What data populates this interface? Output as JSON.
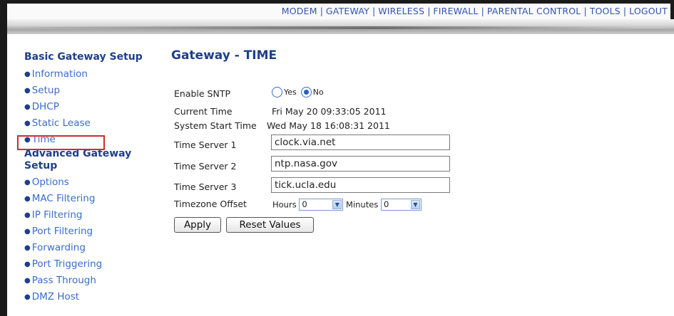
{
  "topnav": {
    "links": [
      "MODEM",
      "GATEWAY",
      "WIRELESS",
      "FIREWALL",
      "PARENTAL CONTROL",
      "TOOLS",
      "LOGOUT"
    ]
  },
  "sidebar": {
    "basic_heading": "Basic Gateway Setup",
    "basic_items": [
      "Information",
      "Setup",
      "DHCP",
      "Static Lease",
      "Time"
    ],
    "advanced_heading_line1": "Advanced Gateway",
    "advanced_heading_line2": "Setup",
    "advanced_items": [
      "Options",
      "MAC Filtering",
      "IP Filtering",
      "Port Filtering",
      "Forwarding",
      "Port Triggering",
      "Pass Through",
      "DMZ Host"
    ],
    "highlighted_item": "Time",
    "highlight_color": "#d22a2a"
  },
  "main": {
    "title": "Gateway - TIME",
    "enable_sntp": {
      "label": "Enable SNTP",
      "options": [
        "Yes",
        "No"
      ],
      "selected": "No"
    },
    "current_time": {
      "label": "Current Time",
      "value": "Fri May 20 09:33:05 2011"
    },
    "system_start_time": {
      "label": "System Start Time",
      "value": "Wed May 18 16:08:31 2011"
    },
    "time_servers": [
      {
        "label": "Time Server 1",
        "value": "clock.via.net"
      },
      {
        "label": "Time Server 2",
        "value": "ntp.nasa.gov"
      },
      {
        "label": "Time Server 3",
        "value": "tick.ucla.edu"
      }
    ],
    "timezone_offset": {
      "label": "Timezone Offset",
      "hours_label": "Hours",
      "hours_value": "0",
      "minutes_label": "Minutes",
      "minutes_value": "0"
    },
    "apply_label": "Apply",
    "reset_label": "Reset Values"
  },
  "colors": {
    "heading": "#1f3f8a",
    "link": "#3a6cc9",
    "frame": "#1a1a1a"
  }
}
